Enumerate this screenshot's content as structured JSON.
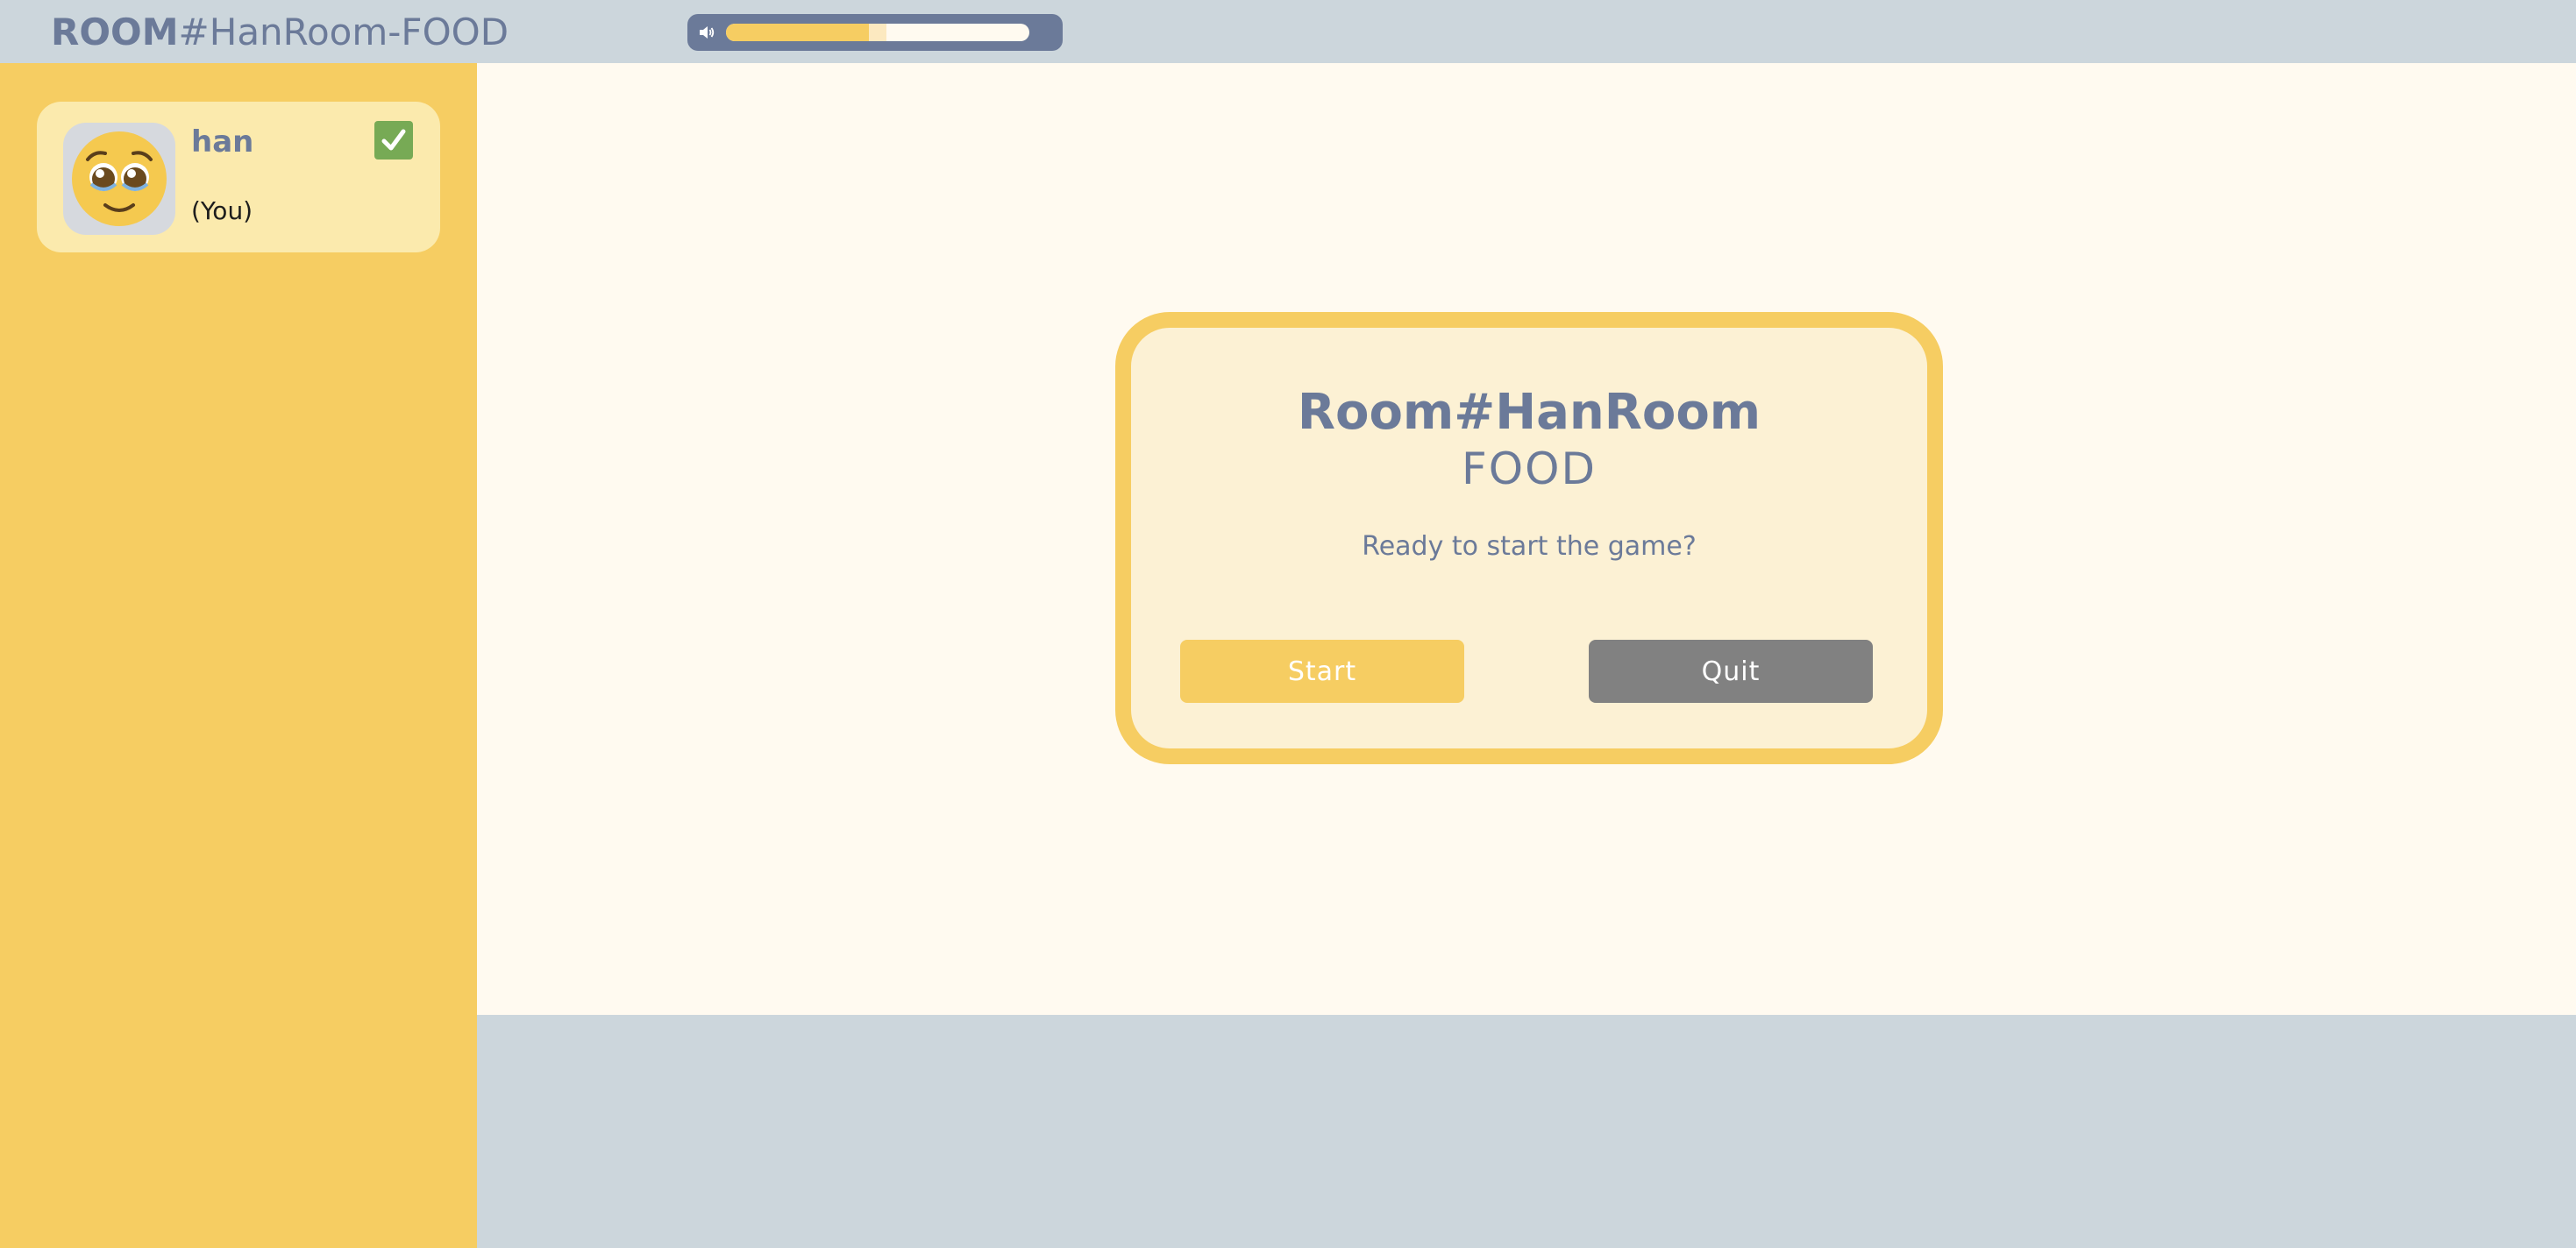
{
  "header": {
    "brand": "ROOM",
    "room_name": "#HanRoom-FOOD",
    "volume": {
      "icon": "speaker-icon",
      "level_fraction": 0.47,
      "buffered_fraction": 0.53
    }
  },
  "sidebar": {
    "players": [
      {
        "name": "han",
        "tag": "(You)",
        "avatar": "pleading-face-emoji",
        "ready": true,
        "ready_icon": "checkmark-icon"
      }
    ]
  },
  "modal": {
    "title": "Room#HanRoom",
    "subtitle": "FOOD",
    "question": "Ready to start the game?",
    "start_label": "Start",
    "quit_label": "Quit"
  },
  "colors": {
    "accent": "#f6cd62",
    "text": "#6b7a99",
    "background": "#fffaf0",
    "ready": "#77aa55",
    "quit": "#818181"
  }
}
